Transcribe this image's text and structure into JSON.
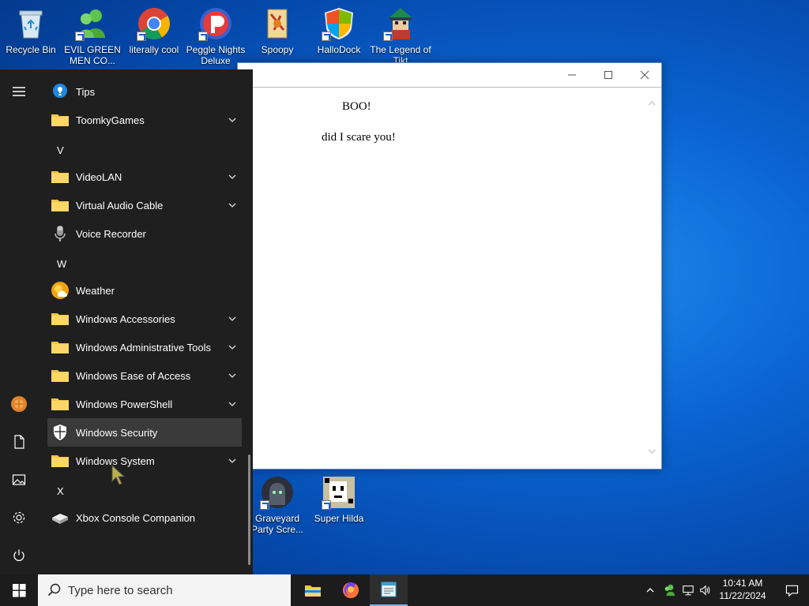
{
  "desktop": {
    "icons": [
      {
        "label": "Recycle Bin"
      },
      {
        "label": "EVIL GREEN MEN CO..."
      },
      {
        "label": "literally cool"
      },
      {
        "label": "Peggle Nights Deluxe"
      },
      {
        "label": "Spoopy"
      },
      {
        "label": "HalloDock"
      },
      {
        "label": "The Legend of Tikt"
      },
      {
        "label": "Graveyard Party Scre..."
      },
      {
        "label": "Super Hilda"
      }
    ]
  },
  "notepad": {
    "line1": "BOO!",
    "line2": "did I scare you!"
  },
  "start_menu": {
    "items": [
      {
        "type": "app",
        "label": "Tips",
        "icon": "lightbulb-icon"
      },
      {
        "type": "folder",
        "label": "ToomkyGames",
        "icon": "folder-icon"
      },
      {
        "type": "letter",
        "label": "V"
      },
      {
        "type": "folder",
        "label": "VideoLAN",
        "icon": "folder-icon"
      },
      {
        "type": "folder",
        "label": "Virtual Audio Cable",
        "icon": "folder-icon"
      },
      {
        "type": "app",
        "label": "Voice Recorder",
        "icon": "microphone-icon"
      },
      {
        "type": "letter",
        "label": "W"
      },
      {
        "type": "app",
        "label": "Weather",
        "icon": "weather-icon"
      },
      {
        "type": "folder",
        "label": "Windows Accessories",
        "icon": "folder-icon"
      },
      {
        "type": "folder",
        "label": "Windows Administrative Tools",
        "icon": "folder-icon"
      },
      {
        "type": "folder",
        "label": "Windows Ease of Access",
        "icon": "folder-icon"
      },
      {
        "type": "folder",
        "label": "Windows PowerShell",
        "icon": "folder-icon"
      },
      {
        "type": "app",
        "label": "Windows Security",
        "icon": "shield-icon",
        "hover": true
      },
      {
        "type": "folder",
        "label": "Windows System",
        "icon": "folder-icon"
      },
      {
        "type": "letter",
        "label": "X"
      },
      {
        "type": "app",
        "label": "Xbox Console Companion",
        "icon": "xbox-console-icon"
      }
    ]
  },
  "taskbar": {
    "search_placeholder": "Type here to search",
    "time": "10:41 AM",
    "date": "11/22/2024"
  },
  "colors": {
    "accent": "#0a64d2",
    "taskbar_bg": "#1c1c1c",
    "start_bg": "#1f1f1f",
    "folder": "#f6c445"
  }
}
